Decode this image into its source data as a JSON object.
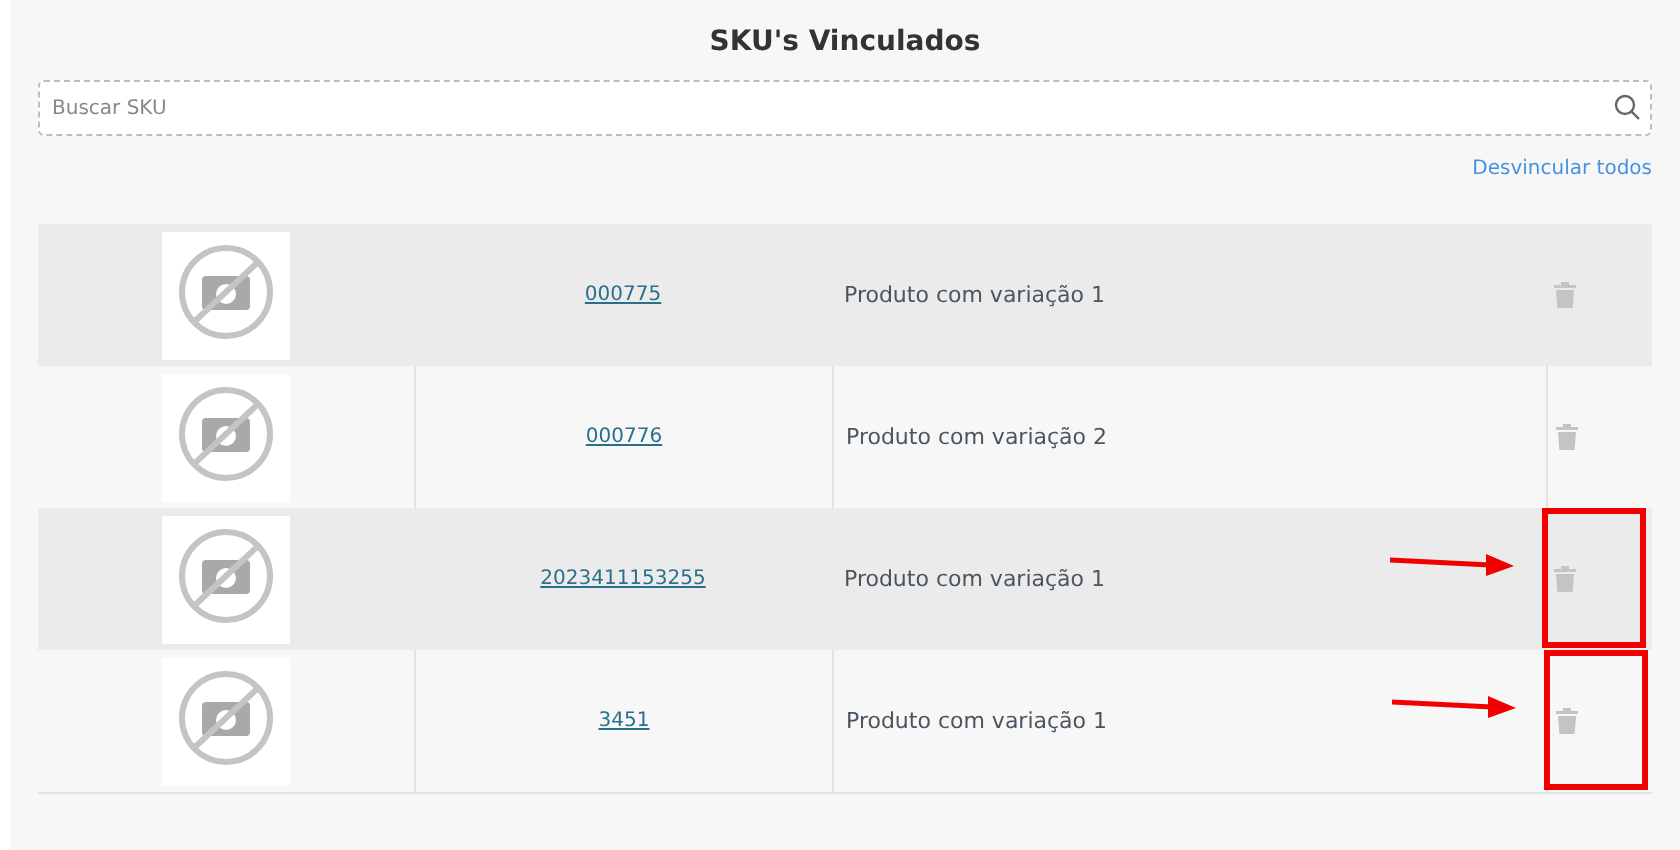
{
  "title": "SKU's Vinculados",
  "search": {
    "placeholder": "Buscar SKU"
  },
  "unlink_all": "Desvincular todos",
  "rows": [
    {
      "sku": "000775",
      "name": "Produto com variação 1",
      "highlighted": false
    },
    {
      "sku": "000776",
      "name": "Produto com variação 2",
      "highlighted": false
    },
    {
      "sku": "2023411153255",
      "name": "Produto com variação 1",
      "highlighted": true
    },
    {
      "sku": "3451",
      "name": "Produto com variação 1",
      "highlighted": true
    }
  ]
}
